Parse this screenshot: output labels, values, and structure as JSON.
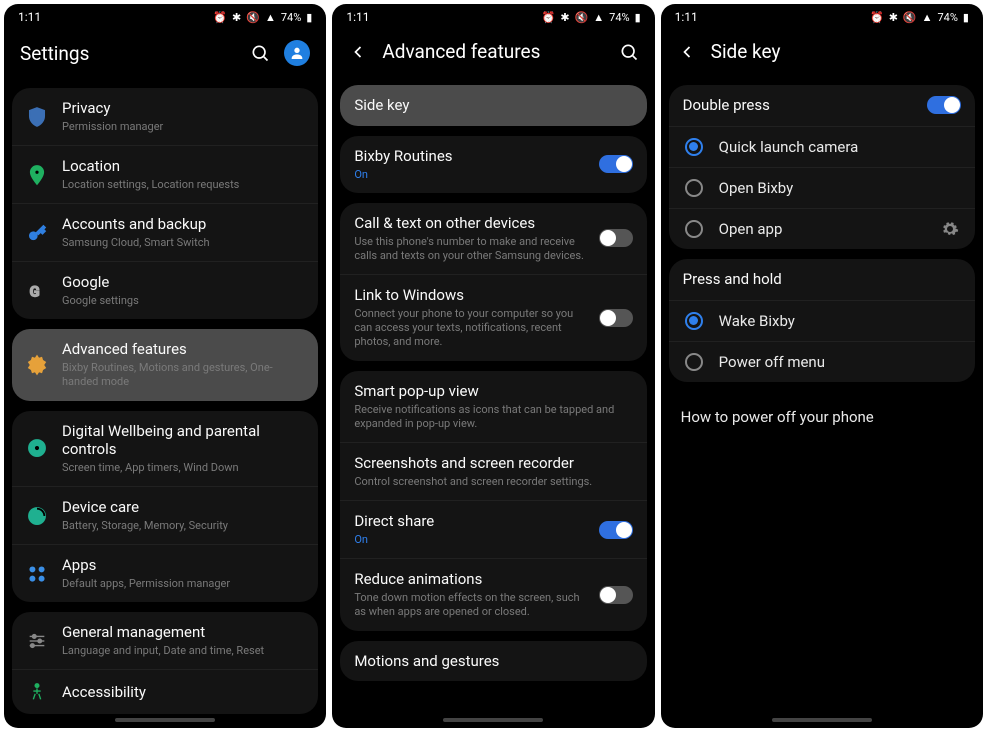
{
  "status": {
    "time": "1:11",
    "battery": "74%"
  },
  "screen1": {
    "header": "Settings",
    "groups": [
      [
        {
          "icon": "shield",
          "title": "Privacy",
          "sub": "Permission manager"
        },
        {
          "icon": "location",
          "title": "Location",
          "sub": "Location settings, Location requests"
        },
        {
          "icon": "key",
          "title": "Accounts and backup",
          "sub": "Samsung Cloud, Smart Switch"
        },
        {
          "icon": "google",
          "title": "Google",
          "sub": "Google settings"
        }
      ],
      [
        {
          "icon": "gear",
          "title": "Advanced features",
          "sub": "Bixby Routines, Motions and gestures, One-handed mode",
          "highlight": true
        }
      ],
      [
        {
          "icon": "wellbeing",
          "title": "Digital Wellbeing and parental controls",
          "sub": "Screen time, App timers, Wind Down"
        },
        {
          "icon": "device",
          "title": "Device care",
          "sub": "Battery, Storage, Memory, Security"
        },
        {
          "icon": "apps",
          "title": "Apps",
          "sub": "Default apps, Permission manager"
        }
      ],
      [
        {
          "icon": "sliders",
          "title": "General management",
          "sub": "Language and input, Date and time, Reset"
        },
        {
          "icon": "access",
          "title": "Accessibility",
          "sub": ""
        }
      ]
    ]
  },
  "screen2": {
    "header": "Advanced features",
    "groups": [
      [
        {
          "title": "Side key",
          "highlight": true
        }
      ],
      [
        {
          "title": "Bixby Routines",
          "sub": "On",
          "subOn": true,
          "toggle": "on"
        }
      ],
      [
        {
          "title": "Call & text on other devices",
          "sub": "Use this phone's number to make and receive calls and texts on your other Samsung devices.",
          "toggle": "off"
        },
        {
          "title": "Link to Windows",
          "sub": "Connect your phone to your computer so you can access your texts, notifications, recent photos, and more.",
          "toggle": "off"
        }
      ],
      [
        {
          "title": "Smart pop-up view",
          "sub": "Receive notifications as icons that can be tapped and expanded in pop-up view."
        },
        {
          "title": "Screenshots and screen recorder",
          "sub": "Control screenshot and screen recorder settings."
        },
        {
          "title": "Direct share",
          "sub": "On",
          "subOn": true,
          "toggle": "on"
        },
        {
          "title": "Reduce animations",
          "sub": "Tone down motion effects on the screen, such as when apps are opened or closed.",
          "toggle": "off"
        }
      ],
      [
        {
          "title": "Motions and gestures"
        }
      ]
    ]
  },
  "screen3": {
    "header": "Side key",
    "sections": [
      {
        "heading": "Double press",
        "toggle": "on",
        "options": [
          {
            "label": "Quick launch camera",
            "selected": true
          },
          {
            "label": "Open Bixby"
          },
          {
            "label": "Open app",
            "gear": true
          }
        ]
      },
      {
        "heading": "Press and hold",
        "options": [
          {
            "label": "Wake Bixby",
            "selected": true
          },
          {
            "label": "Power off menu",
            "highlight": true
          }
        ]
      }
    ],
    "footer": "How to power off your phone"
  }
}
